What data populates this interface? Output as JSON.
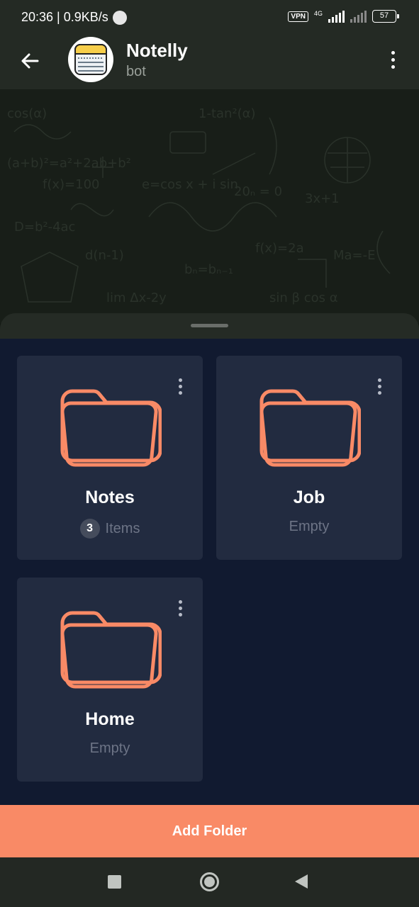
{
  "status_bar": {
    "time_speed": "20:36 | 0.9KB/s",
    "vpn": "VPN",
    "network": "4G",
    "battery": "57"
  },
  "header": {
    "title": "Notelly",
    "subtitle": "bot"
  },
  "folders": [
    {
      "name": "Notes",
      "count": "3",
      "status": "Items"
    },
    {
      "name": "Job",
      "status": "Empty"
    },
    {
      "name": "Home",
      "status": "Empty"
    }
  ],
  "add_button_label": "Add Folder",
  "colors": {
    "accent": "#f98a66",
    "sheet_bg": "#111a30",
    "card_bg": "#222b40",
    "header_bg": "#242a24"
  }
}
